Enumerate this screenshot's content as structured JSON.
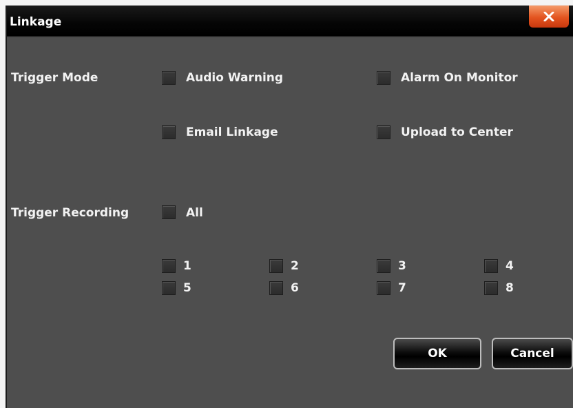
{
  "window": {
    "title": "Linkage"
  },
  "trigger_mode": {
    "label": "Trigger Mode",
    "options": [
      "Audio Warning",
      "Alarm On Monitor",
      "Email Linkage",
      "Upload to Center"
    ]
  },
  "trigger_recording": {
    "label": "Trigger Recording",
    "all_label": "All",
    "channels": [
      "1",
      "2",
      "3",
      "4",
      "5",
      "6",
      "7",
      "8"
    ]
  },
  "buttons": {
    "ok": "OK",
    "cancel": "Cancel"
  },
  "colors": {
    "close_button": "#e3541f",
    "dialog_bg": "#4e4e4e",
    "titlebar": "#000000"
  }
}
